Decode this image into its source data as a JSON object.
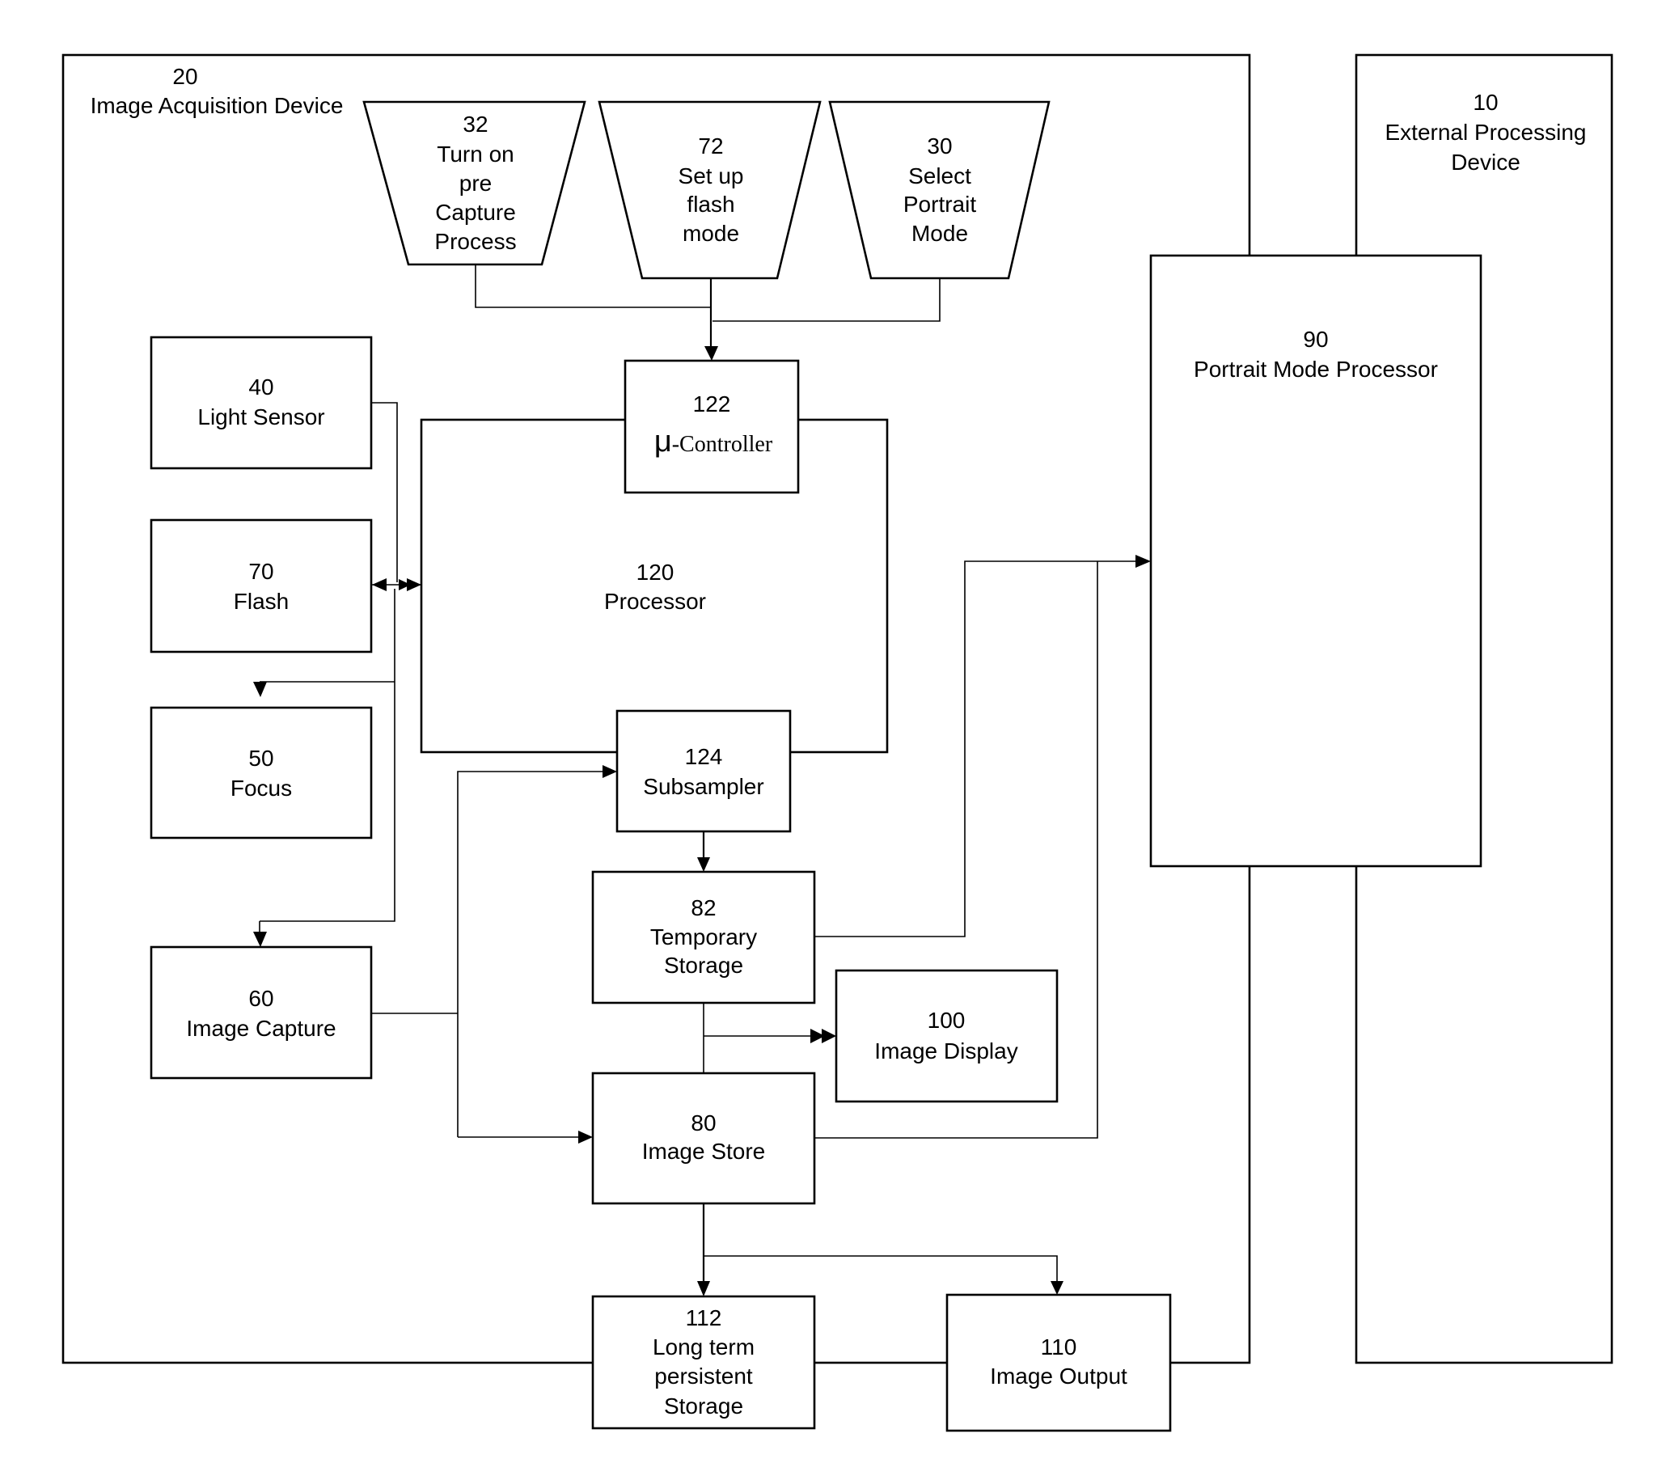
{
  "diagram": {
    "type": "block-diagram",
    "containers": {
      "image_acquisition_device": {
        "ref": "20",
        "label": "Image Acquisition Device"
      },
      "external_processing_device": {
        "ref": "10",
        "lines": [
          "External Processing",
          "Device"
        ]
      }
    },
    "inputs": [
      {
        "id": "pre-capture",
        "ref": "32",
        "lines": [
          "Turn on",
          "pre",
          "Capture",
          "Process"
        ]
      },
      {
        "id": "flash-mode",
        "ref": "72",
        "lines": [
          "Set up",
          "flash",
          "mode"
        ]
      },
      {
        "id": "portrait-mode",
        "ref": "30",
        "lines": [
          "Select",
          "Portrait",
          "Mode"
        ]
      }
    ],
    "blocks": {
      "light_sensor": {
        "ref": "40",
        "lines": [
          "Light Sensor"
        ]
      },
      "flash": {
        "ref": "70",
        "lines": [
          "Flash"
        ]
      },
      "focus": {
        "ref": "50",
        "lines": [
          "Focus"
        ]
      },
      "image_capture": {
        "ref": "60",
        "lines": [
          "Image Capture"
        ]
      },
      "processor": {
        "ref": "120",
        "lines": [
          "Processor"
        ]
      },
      "controller": {
        "ref": "122",
        "mu": "μ",
        "label": "-Controller"
      },
      "subsampler": {
        "ref": "124",
        "lines": [
          "Subsampler"
        ]
      },
      "temporary_storage": {
        "ref": "82",
        "lines": [
          "Temporary",
          "Storage"
        ]
      },
      "image_display": {
        "ref": "100",
        "lines": [
          "Image Display"
        ]
      },
      "image_store": {
        "ref": "80",
        "lines": [
          "Image Store"
        ]
      },
      "long_term_storage": {
        "ref": "112",
        "lines": [
          "Long term",
          "persistent",
          "Storage"
        ]
      },
      "image_output": {
        "ref": "110",
        "lines": [
          "Image Output"
        ]
      },
      "portrait_mode_processor": {
        "ref": "90",
        "lines": [
          "Portrait Mode Processor"
        ]
      }
    },
    "connections": [
      {
        "from": "32",
        "to": "122"
      },
      {
        "from": "72",
        "to": "122"
      },
      {
        "from": "30",
        "to": "122"
      },
      {
        "from": "40",
        "to": "120"
      },
      {
        "from": "120",
        "to": "70",
        "bidirectional": true
      },
      {
        "from": "120",
        "to": "50"
      },
      {
        "from": "120",
        "to": "60"
      },
      {
        "from": "60",
        "to": "124"
      },
      {
        "from": "60",
        "to": "80"
      },
      {
        "from": "124",
        "to": "82"
      },
      {
        "from": "82",
        "to": "100"
      },
      {
        "from": "82",
        "to": "80"
      },
      {
        "from": "82",
        "to": "90"
      },
      {
        "from": "80",
        "to": "90"
      },
      {
        "from": "80",
        "to": "112"
      },
      {
        "from": "80",
        "to": "110"
      }
    ]
  }
}
